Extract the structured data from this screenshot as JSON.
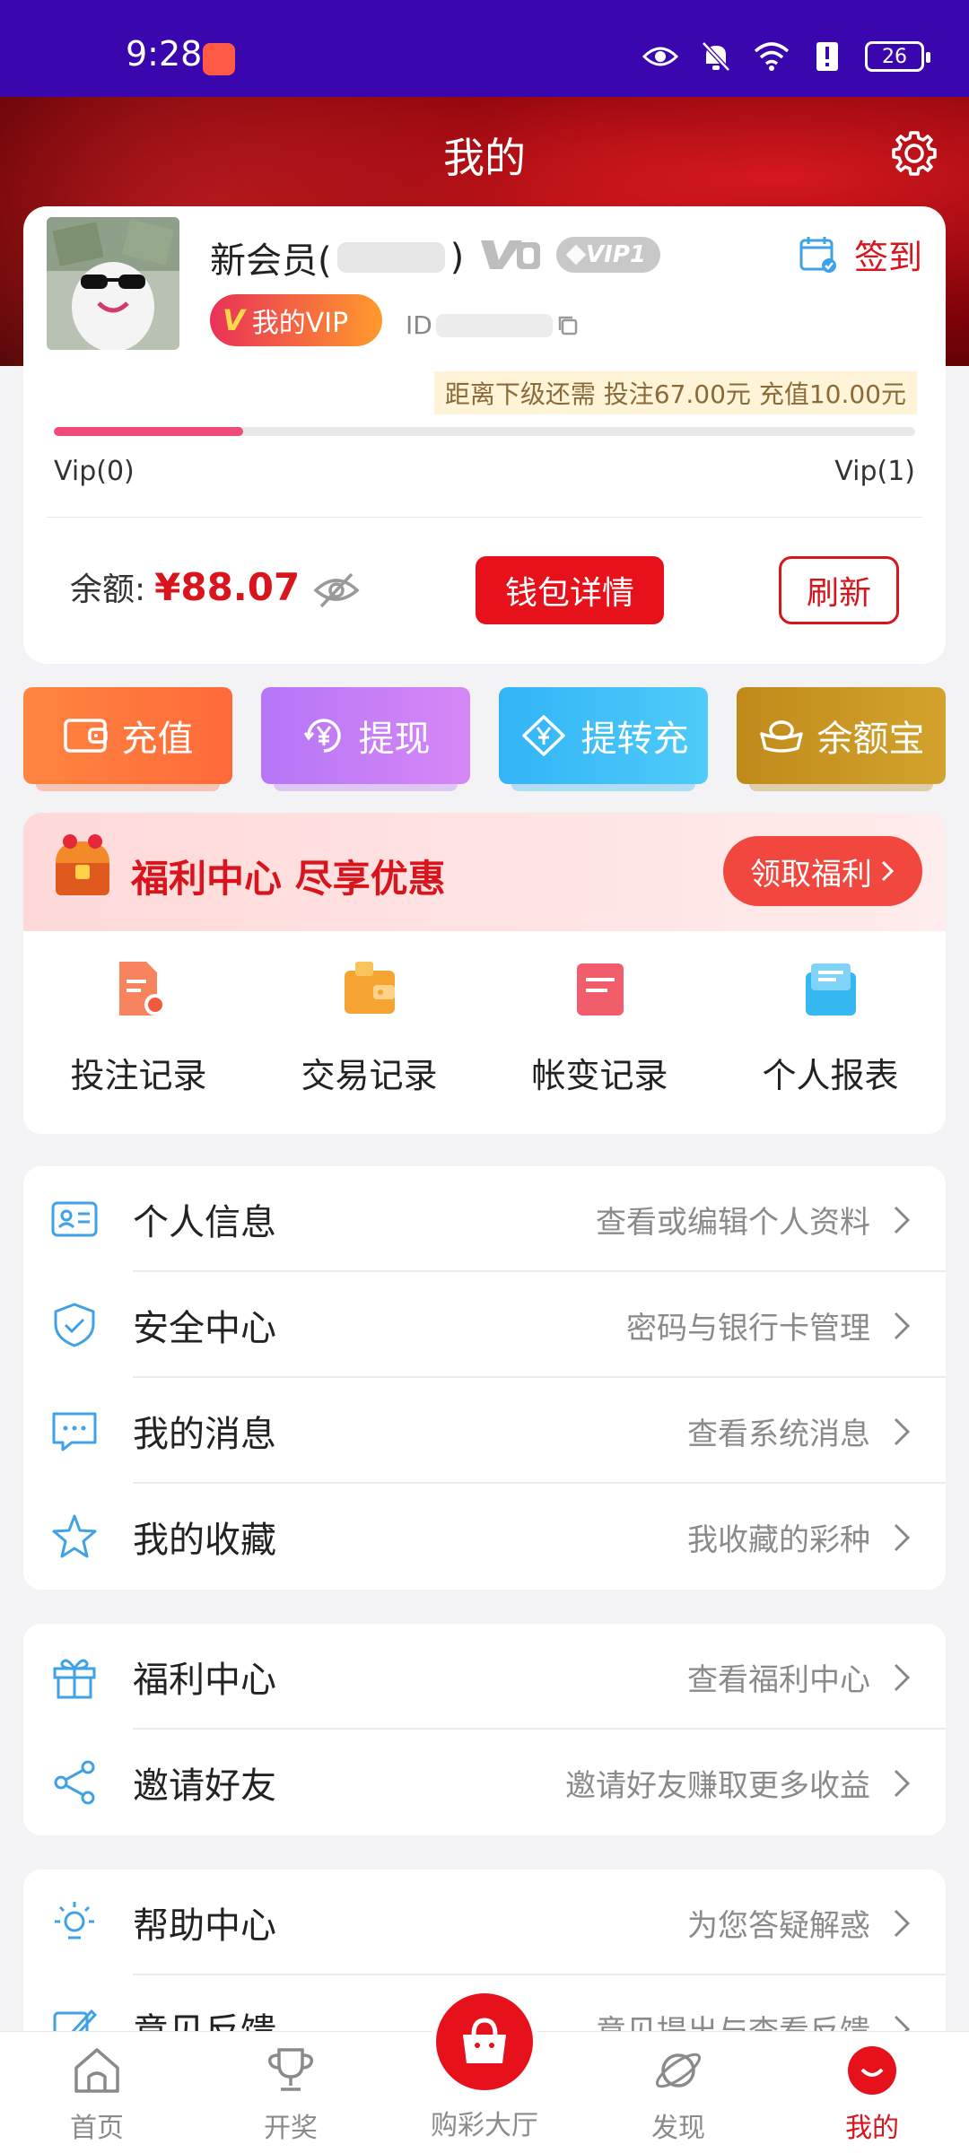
{
  "status_bar": {
    "time": "9:28",
    "battery": "26"
  },
  "header": {
    "title": "我的"
  },
  "user": {
    "nickname_prefix": "新会员(",
    "nickname_suffix": ")",
    "level_badge": "VIP1",
    "my_vip_label": "我的VIP",
    "id_prefix": "ID",
    "signin_label": "签到",
    "next_level_text": "距离下级还需  投注67.00元  充值10.00元",
    "progress_fraction": 0.22,
    "vip_from": "Vip(0)",
    "vip_to": "Vip(1)",
    "balance_label": "余额:",
    "balance_value": "¥88.07",
    "wallet_button": "钱包详情",
    "refresh_button": "刷新"
  },
  "actions": [
    {
      "label": "充值"
    },
    {
      "label": "提现"
    },
    {
      "label": "提转充"
    },
    {
      "label": "余额宝"
    }
  ],
  "welfare": {
    "title": "福利中心 尽享优惠",
    "claim_button": "领取福利",
    "records": [
      {
        "label": "投注记录"
      },
      {
        "label": "交易记录"
      },
      {
        "label": "帐变记录"
      },
      {
        "label": "个人报表"
      }
    ]
  },
  "menu_group1": [
    {
      "title": "个人信息",
      "subtitle": "查看或编辑个人资料"
    },
    {
      "title": "安全中心",
      "subtitle": "密码与银行卡管理"
    },
    {
      "title": "我的消息",
      "subtitle": "查看系统消息"
    },
    {
      "title": "我的收藏",
      "subtitle": "我收藏的彩种"
    }
  ],
  "menu_group2": [
    {
      "title": "福利中心",
      "subtitle": "查看福利中心"
    },
    {
      "title": "邀请好友",
      "subtitle": "邀请好友赚取更多收益"
    }
  ],
  "menu_group3": [
    {
      "title": "帮助中心",
      "subtitle": "为您答疑解惑"
    },
    {
      "title": "意见反馈",
      "subtitle": "意见提出与查看反馈"
    }
  ],
  "tabbar": [
    {
      "label": "首页"
    },
    {
      "label": "开奖"
    },
    {
      "label": "购彩大厅"
    },
    {
      "label": "发现"
    },
    {
      "label": "我的"
    }
  ],
  "colors": {
    "primary_red": "#d8141c",
    "status_bar": "#3a06ad",
    "progress": "#f04a7a"
  }
}
